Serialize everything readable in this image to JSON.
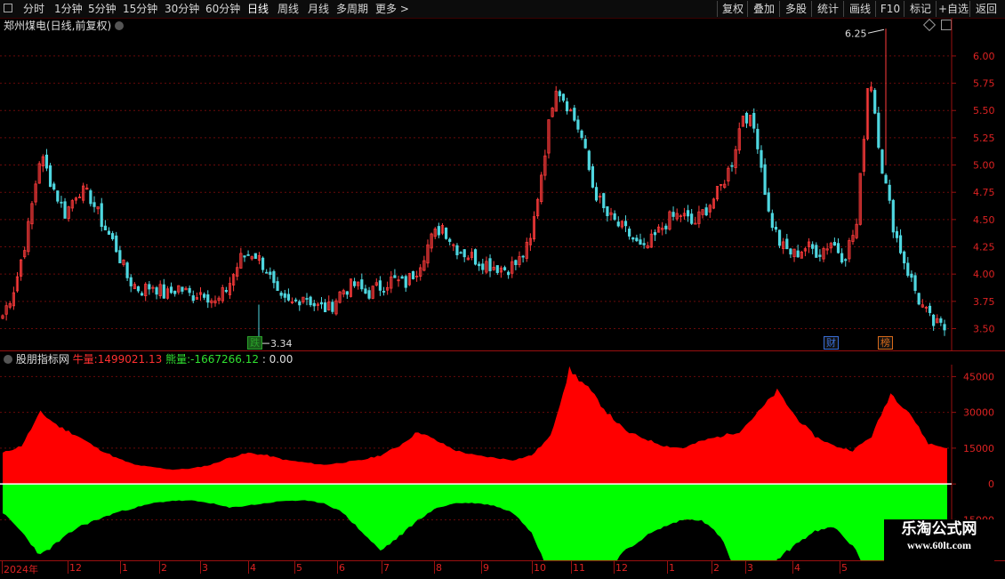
{
  "toolbar": {
    "periods": [
      "分时",
      "1分钟",
      "5分钟",
      "15分钟",
      "30分钟",
      "60分钟",
      "日线",
      "周线",
      "月线",
      "多周期",
      "更多 >"
    ],
    "active_period": "日线",
    "buttons": [
      "复权",
      "叠加",
      "多股",
      "统计",
      "画线",
      "F10",
      "标记",
      "+自选",
      "返回"
    ]
  },
  "main_chart": {
    "title": "郑州煤电(日线,前复权)",
    "high_marker": "6.25",
    "low_marker": "3.34",
    "badges": [
      {
        "text": "跌",
        "color": "#2aa02a"
      },
      {
        "text": "财",
        "color": "#3a6fd8"
      },
      {
        "text": "榜",
        "color": "#d86a1a"
      }
    ],
    "colors": {
      "up": "#ff3b3b",
      "down": "#4fd7e0",
      "grid": "#7a1010"
    }
  },
  "indicator": {
    "name": "股朋指标网",
    "bull_label": "牛量:",
    "bull_value": "1499021.13",
    "bear_label": "熊量:",
    "bear_value": "-1667266.12",
    "extra_value": ": 0.00",
    "colors": {
      "bull": "#ff0000",
      "bear": "#00ff00",
      "bull_label": "#ff3030",
      "bear_label": "#30e030"
    }
  },
  "x_axis": {
    "labels": [
      "2024年",
      "12",
      "1",
      "2",
      "3",
      "4",
      "5",
      "6",
      "7",
      "8",
      "9",
      "10",
      "11",
      "12",
      "1",
      "2",
      "3",
      "4",
      "5"
    ]
  },
  "watermark": {
    "line1": "乐淘公式网",
    "line2": "www.60lt.com"
  },
  "chart_data": [
    {
      "type": "candlestick",
      "title": "郑州煤电(日线,前复权)",
      "y_ticks": [
        3.5,
        3.75,
        4.0,
        4.25,
        4.5,
        4.75,
        5.0,
        5.25,
        5.5,
        5.75,
        6.0
      ],
      "ylim": [
        3.3,
        6.35
      ],
      "max_annotation": 6.25,
      "min_annotation": 3.34,
      "close_path": [
        3.62,
        3.9,
        4.4,
        5.1,
        4.8,
        4.55,
        4.78,
        4.7,
        4.45,
        4.25,
        3.95,
        3.85,
        3.9,
        3.8,
        3.88,
        3.8,
        3.85,
        3.72,
        3.9,
        4.15,
        4.2,
        4.05,
        3.75,
        3.72,
        3.82,
        3.7,
        3.68,
        3.85,
        3.9,
        3.82,
        3.88,
        3.95,
        3.9,
        4.05,
        4.3,
        4.45,
        4.25,
        4.18,
        4.12,
        4.08,
        4.05,
        4.1,
        4.28,
        5.0,
        5.75,
        5.55,
        5.3,
        4.8,
        4.55,
        4.45,
        4.35,
        4.2,
        4.35,
        4.5,
        4.55,
        4.45,
        4.6,
        4.75,
        5.0,
        5.5,
        5.3,
        4.55,
        4.25,
        4.18,
        4.25,
        4.2,
        4.3,
        4.15,
        4.45,
        5.9,
        5.0,
        4.4,
        4.05,
        3.75,
        3.55,
        3.5
      ]
    },
    {
      "type": "area",
      "series": [
        {
          "name": "牛量",
          "values": [
            13000,
            16000,
            30000,
            24000,
            20000,
            15000,
            11000,
            8000,
            7000,
            6000,
            6500,
            8000,
            11000,
            13000,
            12000,
            10000,
            9000,
            8000,
            9000,
            10000,
            12000,
            16000,
            22000,
            18000,
            14000,
            12000,
            11000,
            10000,
            12000,
            20000,
            48000,
            40000,
            30000,
            22000,
            19000,
            16000,
            15000,
            18000,
            20000,
            22000,
            30000,
            39000,
            28000,
            20000,
            16000,
            14000,
            20000,
            38000,
            30000,
            17000,
            15000
          ]
        },
        {
          "name": "熊量",
          "values": [
            -12000,
            -20000,
            -30000,
            -24000,
            -18000,
            -15000,
            -12000,
            -10000,
            -8000,
            -7000,
            -7000,
            -8000,
            -10000,
            -9000,
            -8000,
            -7000,
            -7000,
            -8000,
            -12000,
            -20000,
            -28000,
            -22000,
            -15000,
            -10000,
            -8000,
            -8000,
            -9000,
            -12000,
            -20000,
            -38000,
            -45000,
            -42000,
            -35000,
            -28000,
            -22000,
            -18000,
            -15000,
            -15000,
            -22000,
            -40000,
            -50000,
            -32000,
            -25000,
            -20000,
            -18000,
            -26000,
            -40000,
            -40000,
            -35000,
            -20000,
            -15000
          ]
        }
      ],
      "y_ticks": [
        -15000,
        0,
        15000,
        30000,
        45000
      ],
      "ylim": [
        -32000,
        50000
      ]
    }
  ]
}
